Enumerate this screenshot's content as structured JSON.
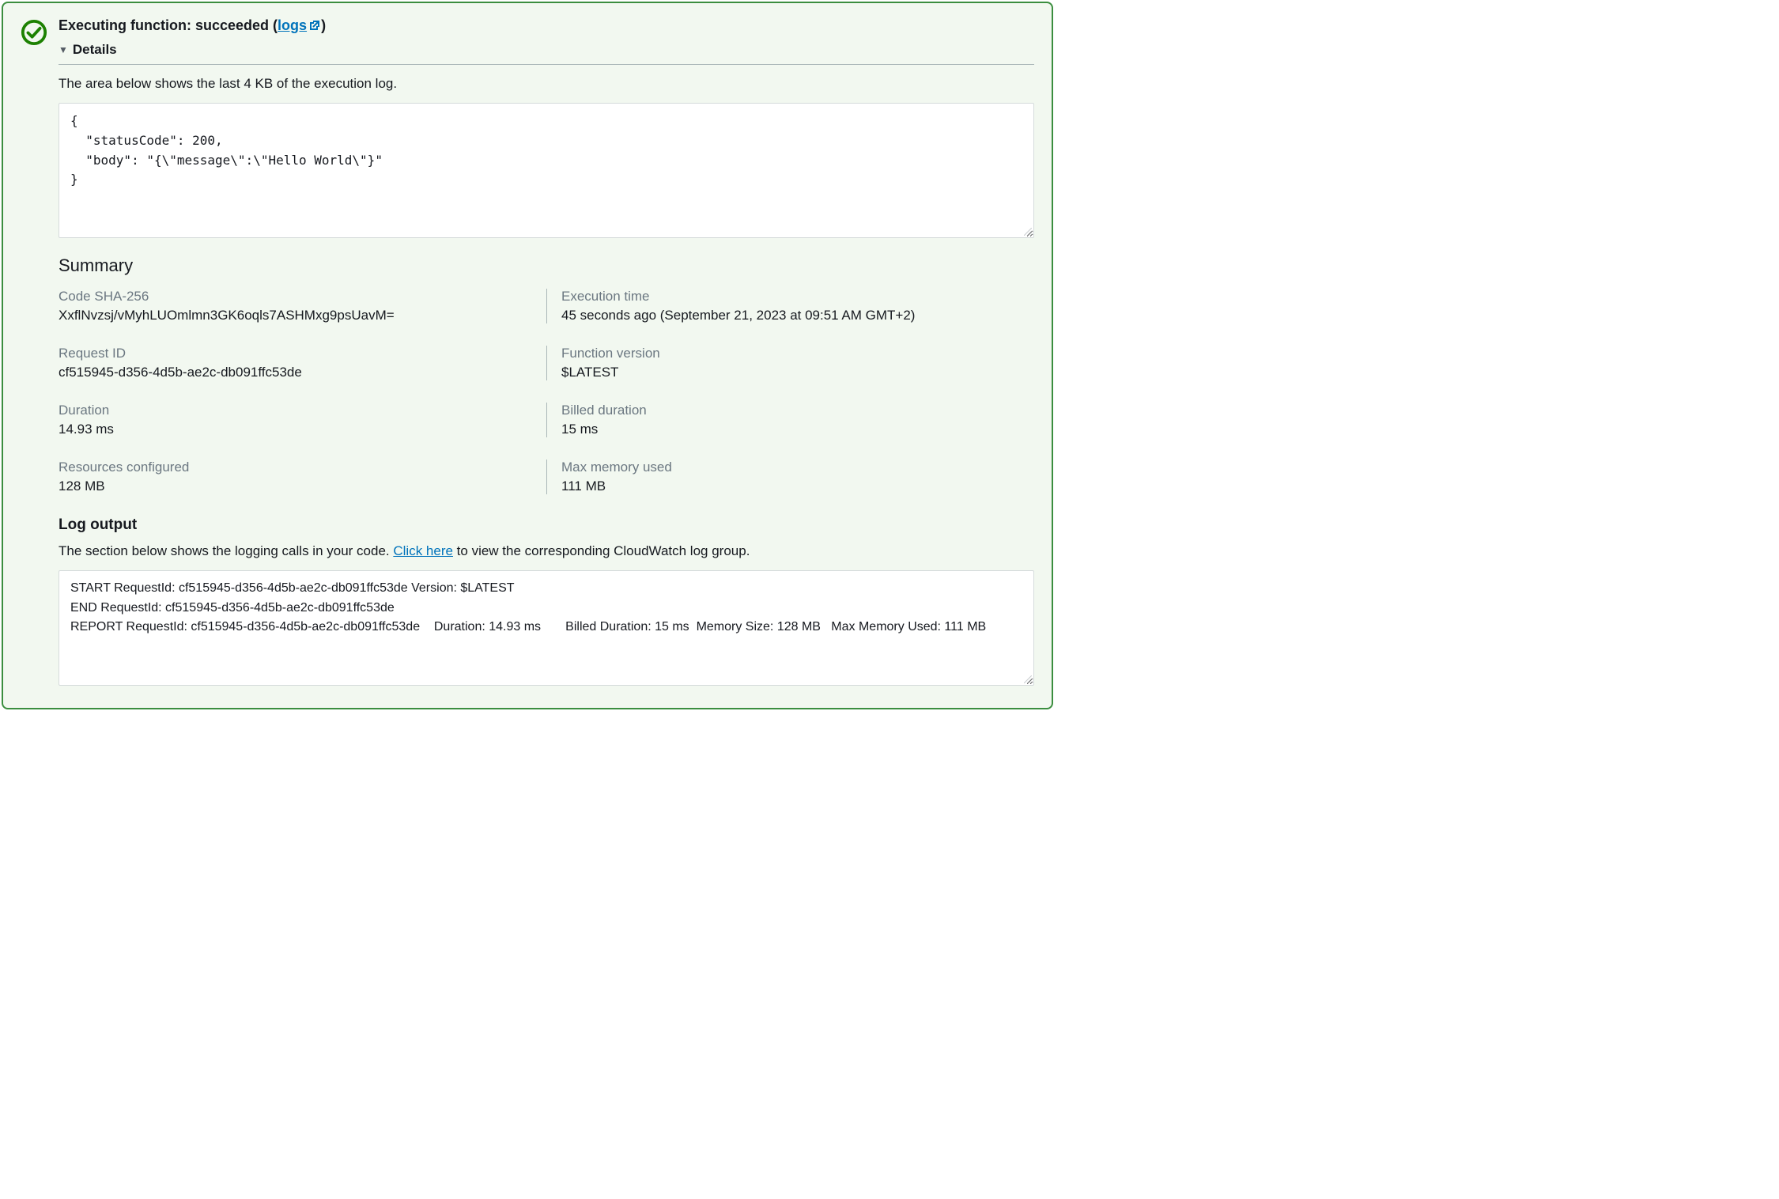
{
  "header": {
    "title_prefix": "Executing function: succeeded (",
    "logs_link_text": "logs",
    "title_suffix": ")",
    "details_label": "Details"
  },
  "execution": {
    "intro": "The area below shows the last 4 KB of the execution log.",
    "response_body": "{\n  \"statusCode\": 200,\n  \"body\": \"{\\\"message\\\":\\\"Hello World\\\"}\"\n}"
  },
  "summary": {
    "heading": "Summary",
    "fields": {
      "code_sha_label": "Code SHA-256",
      "code_sha_value": "XxflNvzsj/vMyhLUOmlmn3GK6oqls7ASHMxg9psUavM=",
      "exec_time_label": "Execution time",
      "exec_time_value": "45 seconds ago (September 21, 2023 at 09:51 AM GMT+2)",
      "request_id_label": "Request ID",
      "request_id_value": "cf515945-d356-4d5b-ae2c-db091ffc53de",
      "version_label": "Function version",
      "version_value": "$LATEST",
      "duration_label": "Duration",
      "duration_value": "14.93 ms",
      "billed_label": "Billed duration",
      "billed_value": "15 ms",
      "resources_label": "Resources configured",
      "resources_value": "128 MB",
      "maxmem_label": "Max memory used",
      "maxmem_value": "111 MB"
    }
  },
  "log": {
    "heading": "Log output",
    "intro_prefix": "The section below shows the logging calls in your code. ",
    "click_here": "Click here",
    "intro_suffix": " to view the corresponding CloudWatch log group.",
    "content": "START RequestId: cf515945-d356-4d5b-ae2c-db091ffc53de Version: $LATEST\nEND RequestId: cf515945-d356-4d5b-ae2c-db091ffc53de\nREPORT RequestId: cf515945-d356-4d5b-ae2c-db091ffc53de    Duration: 14.93 ms       Billed Duration: 15 ms  Memory Size: 128 MB   Max Memory Used: 111 MB"
  }
}
